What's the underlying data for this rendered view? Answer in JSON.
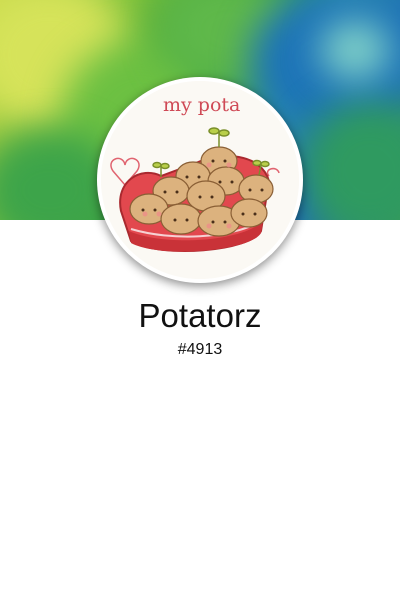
{
  "profile": {
    "username": "Potatorz",
    "discriminator": "#4913",
    "avatar_text": "my pota"
  },
  "icons": {
    "avatar": "potato-heart-box-illustration",
    "banner": "watercolor-green-blue-banner"
  },
  "colors": {
    "banner_green": "#4faa3a",
    "banner_blue": "#1e6fb6",
    "heart_box_red": "#e2484e",
    "potato": "#dcb27e"
  }
}
